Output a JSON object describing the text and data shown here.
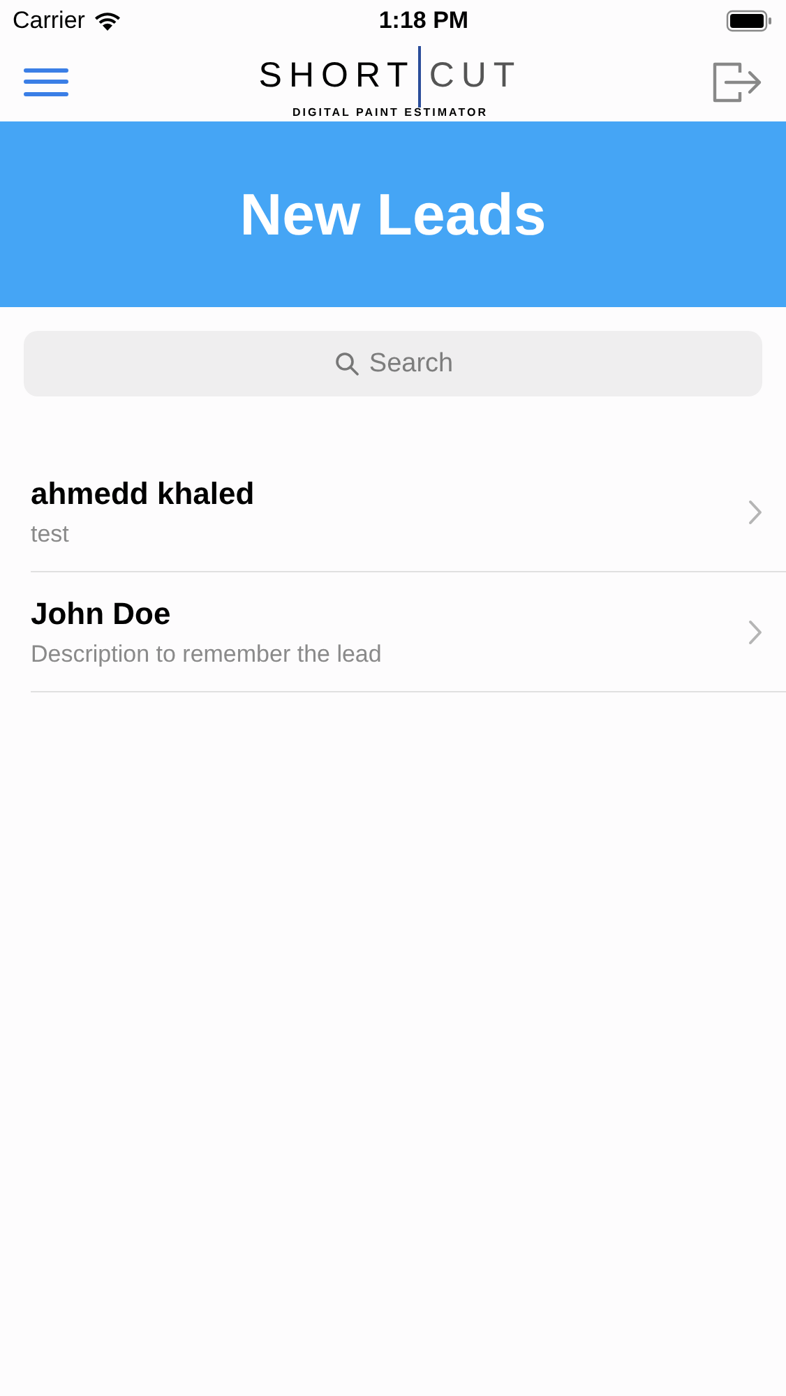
{
  "status_bar": {
    "carrier": "Carrier",
    "time": "1:18 PM"
  },
  "header": {
    "logo_left": "SHORT",
    "logo_right": "CUT",
    "tagline": "DIGITAL PAINT ESTIMATOR"
  },
  "banner": {
    "title": "New Leads"
  },
  "search": {
    "placeholder": "Search"
  },
  "leads": [
    {
      "name": "ahmedd khaled",
      "description": "test"
    },
    {
      "name": "John Doe",
      "description": "Description to remember the lead"
    }
  ]
}
